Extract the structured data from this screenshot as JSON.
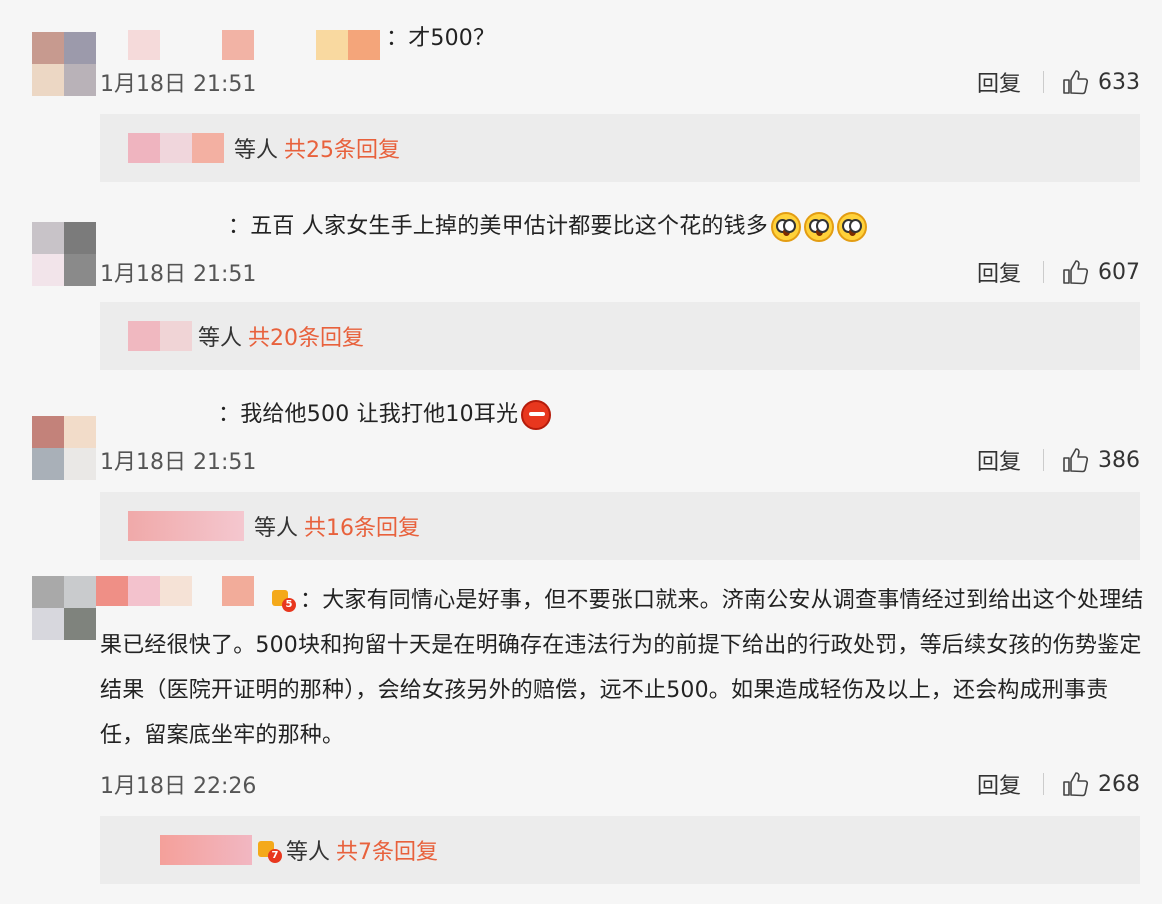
{
  "comments": [
    {
      "text": "：才500？",
      "time": "1月18日 21:51",
      "reply_label": "回复",
      "likes": "633",
      "replies_who": "等人",
      "replies_count": "共25条回复"
    },
    {
      "text": "：五百 人家女生手上掉的美甲估计都要比这个花的钱多",
      "time": "1月18日 21:51",
      "reply_label": "回复",
      "likes": "607",
      "replies_who": "等人",
      "replies_count": "共20条回复",
      "emoji": "shocked-face-icon"
    },
    {
      "text": "：我给他500 让我打他10耳光",
      "time": "1月18日 21:51",
      "reply_label": "回复",
      "likes": "386",
      "replies_who": "等人",
      "replies_count": "共16条回复",
      "emoji": "angry-face-icon"
    },
    {
      "text": "：大家有同情心是好事，但不要张口就来。济南公安从调查事情经过到给出这个处理结果已经很快了。500块和拘留十天是在明确存在违法行为的前提下给出的行政处罚，等后续女孩的伤势鉴定结果（医院开证明的那种），会给女孩另外的赔偿，远不止500。如果造成轻伤及以上，还会构成刑事责任，留案底坐牢的那种。",
      "time": "1月18日 22:26",
      "reply_label": "回复",
      "likes": "268",
      "replies_who": "等人",
      "replies_count": "共7条回复"
    }
  ],
  "icons": {
    "like": "thumbs-up-icon",
    "vip_badge": "vip-badge-icon"
  },
  "colors": {
    "background": "#f6f6f6",
    "reply_box": "#ececec",
    "reply_count": "#e8613c"
  }
}
